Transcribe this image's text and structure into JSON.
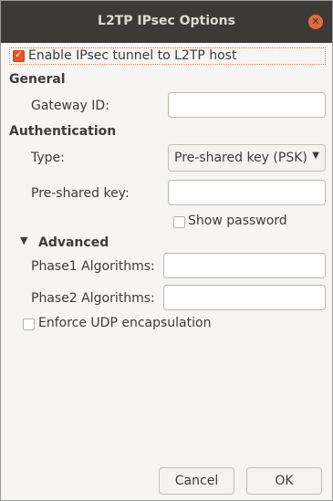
{
  "window": {
    "title": "L2TP IPsec Options",
    "close_glyph": "✕"
  },
  "enable_ipsec": {
    "label": "Enable IPsec tunnel to L2TP host",
    "checked": true
  },
  "general": {
    "heading": "General",
    "gateway_id_label": "Gateway ID:",
    "gateway_id_value": ""
  },
  "authentication": {
    "heading": "Authentication",
    "type_label": "Type:",
    "type_value": "Pre-shared key (PSK)",
    "psk_label": "Pre-shared key:",
    "psk_value": "",
    "show_password_label": "Show password",
    "show_password_checked": false
  },
  "advanced": {
    "heading": "Advanced",
    "expander_glyph": "▼",
    "phase1_label": "Phase1 Algorithms:",
    "phase1_value": "",
    "phase2_label": "Phase2 Algorithms:",
    "phase2_value": "",
    "udp_label": "Enforce UDP encapsulation",
    "udp_checked": false
  },
  "buttons": {
    "cancel": "Cancel",
    "ok": "OK"
  },
  "icons": {
    "close": "close-icon",
    "dropdown": "chevron-down-icon",
    "expander": "triangle-down-icon"
  },
  "colors": {
    "accent": "#e95420",
    "titlebar": "#3b3a36"
  }
}
